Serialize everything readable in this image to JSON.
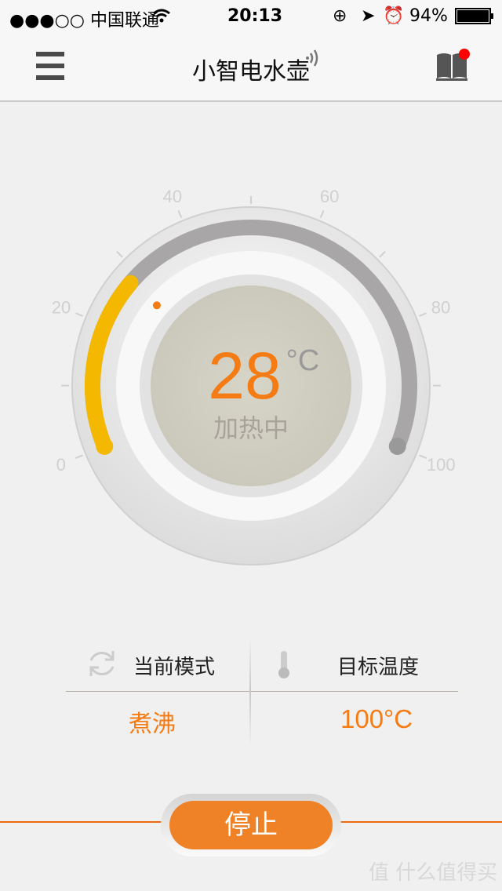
{
  "status_bar": {
    "carrier": "●●●○○ 中国联通",
    "time": "20:13",
    "battery": "94%"
  },
  "header": {
    "title": "小智电水壶",
    "menu_icon": "hamburger-icon",
    "wifi_icon": "signal-waves-icon",
    "manual_icon": "book-icon",
    "notification_color": "#ff0000"
  },
  "dial": {
    "scale_labels": [
      "0",
      "20",
      "40",
      "60",
      "80",
      "100"
    ],
    "scale_min": 0,
    "scale_max": 100,
    "current_temperature": 28,
    "temperature_text": "28",
    "unit": "°C",
    "state": "加热中",
    "progress_color": "#f5b800",
    "track_color": "#a8a6a6",
    "accent": "#f57c14"
  },
  "info": {
    "mode_label": "当前模式",
    "mode_value": "煮沸",
    "target_label": "目标温度",
    "target_value": "100°C"
  },
  "actions": {
    "stop_label": "停止"
  },
  "watermark": "值 什么值得买"
}
